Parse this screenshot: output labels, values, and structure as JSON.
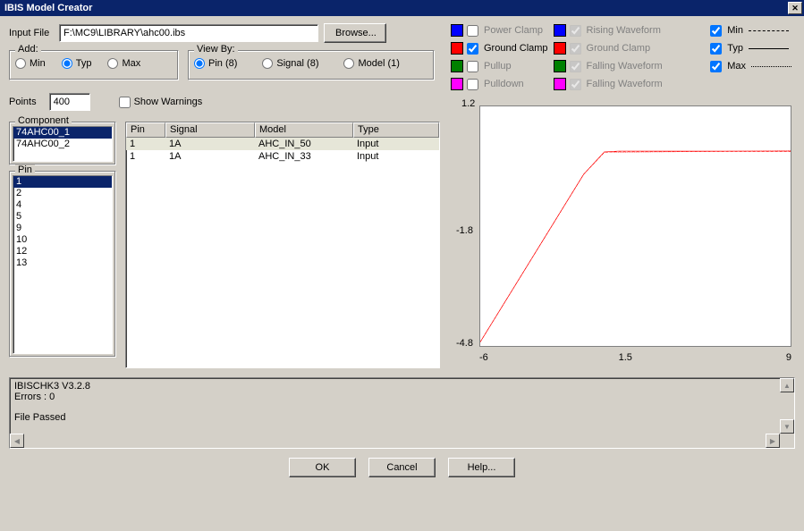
{
  "title": "IBIS Model Creator",
  "input_file": {
    "label": "Input File",
    "value": "F:\\MC9\\LIBRARY\\ahc00.ibs",
    "browse": "Browse..."
  },
  "add": {
    "legend": "Add:",
    "min": "Min",
    "typ": "Typ",
    "max": "Max",
    "selected": "typ"
  },
  "view_by": {
    "legend": "View By:",
    "pin": "Pin (8)",
    "signal": "Signal (8)",
    "model": "Model (1)",
    "selected": "pin"
  },
  "points": {
    "label": "Points",
    "value": "400"
  },
  "show_warnings": "Show Warnings",
  "curves": {
    "power_clamp": "Power Clamp",
    "ground_clamp": "Ground Clamp",
    "pullup": "Pullup",
    "pulldown": "Pulldown",
    "rising_waveform": "Rising Waveform",
    "ground_clamp2": "Ground Clamp",
    "falling_waveform": "Falling Waveform",
    "falling_waveform2": "Falling Waveform",
    "colors": {
      "power_clamp": "#0000ff",
      "ground_clamp": "#ff0000",
      "pullup": "#008000",
      "pulldown": "#ff00ff",
      "rising_waveform": "#0000ff",
      "ground_clamp2": "#ff0000",
      "falling_waveform": "#008000",
      "falling_waveform2": "#ff00ff"
    }
  },
  "legend_lines": {
    "min": "Min",
    "typ": "Typ",
    "max": "Max"
  },
  "component": {
    "legend": "Component",
    "items": [
      "74AHC00_1",
      "74AHC00_2"
    ],
    "selected": 0
  },
  "pin": {
    "legend": "Pin",
    "items": [
      "1",
      "2",
      "4",
      "5",
      "9",
      "10",
      "12",
      "13"
    ],
    "selected": 0
  },
  "table": {
    "headers": [
      "Pin",
      "Signal",
      "Model",
      "Type"
    ],
    "rows": [
      {
        "pin": "1",
        "signal": "1A",
        "model": "AHC_IN_50",
        "type": "Input"
      },
      {
        "pin": "1",
        "signal": "1A",
        "model": "AHC_IN_33",
        "type": "Input"
      }
    ],
    "selected": 0
  },
  "chart_data": {
    "type": "line",
    "xlim": [
      -6,
      9
    ],
    "ylim": [
      -4.8,
      1.2
    ],
    "xticks": [
      -6,
      1.5,
      9
    ],
    "yticks": [
      -4.8,
      -1.8,
      1.2
    ],
    "series": [
      {
        "name": "typ",
        "color": "#ff0000",
        "points": [
          [
            -6,
            -4.7
          ],
          [
            -1,
            -0.5
          ],
          [
            0,
            0.06
          ],
          [
            0.7,
            0.08
          ],
          [
            9,
            0.08
          ]
        ]
      },
      {
        "name": "min",
        "color": "#ff0000",
        "points": [
          [
            -6,
            -4.7
          ],
          [
            -1,
            -0.5
          ],
          [
            0,
            0.05
          ],
          [
            0.7,
            0.07
          ],
          [
            9,
            0.07
          ]
        ]
      },
      {
        "name": "max",
        "color": "#ff0000",
        "points": [
          [
            -6,
            -4.7
          ],
          [
            -1,
            -0.5
          ],
          [
            0,
            0.06
          ],
          [
            0.6,
            0.05
          ],
          [
            9,
            0.09
          ]
        ]
      }
    ]
  },
  "log": {
    "line1": "IBISCHK3 V3.2.8",
    "line2": "Errors  : 0",
    "line3": "File Passed"
  },
  "buttons": {
    "ok": "OK",
    "cancel": "Cancel",
    "help": "Help..."
  }
}
